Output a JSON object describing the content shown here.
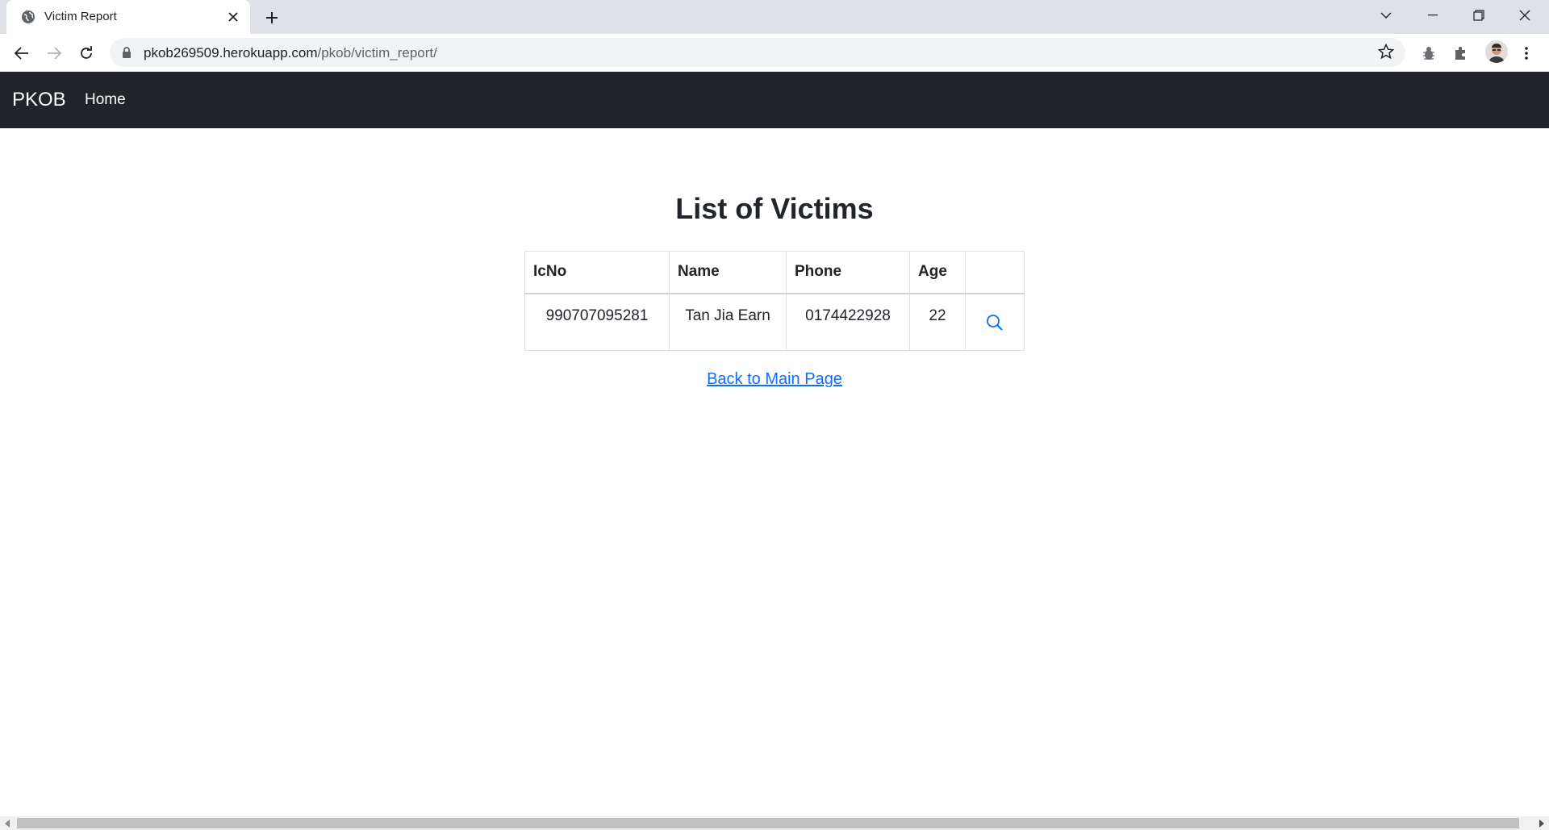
{
  "browser": {
    "tab_title": "Victim Report",
    "url_host": "pkob269509.herokuapp.com",
    "url_path": "/pkob/victim_report/"
  },
  "navbar": {
    "brand": "PKOB",
    "home_label": "Home"
  },
  "main": {
    "title": "List of Victims",
    "table": {
      "headers": [
        "IcNo",
        "Name",
        "Phone",
        "Age",
        ""
      ],
      "rows": [
        {
          "icno": "990707095281",
          "name": "Tan Jia Earn",
          "phone": "0174422928",
          "age": "22",
          "action_icon": "search-icon"
        }
      ]
    },
    "back_link": "Back to Main Page"
  },
  "colors": {
    "navbar_bg": "#212529",
    "link": "#0d6efd",
    "text": "#212529"
  }
}
